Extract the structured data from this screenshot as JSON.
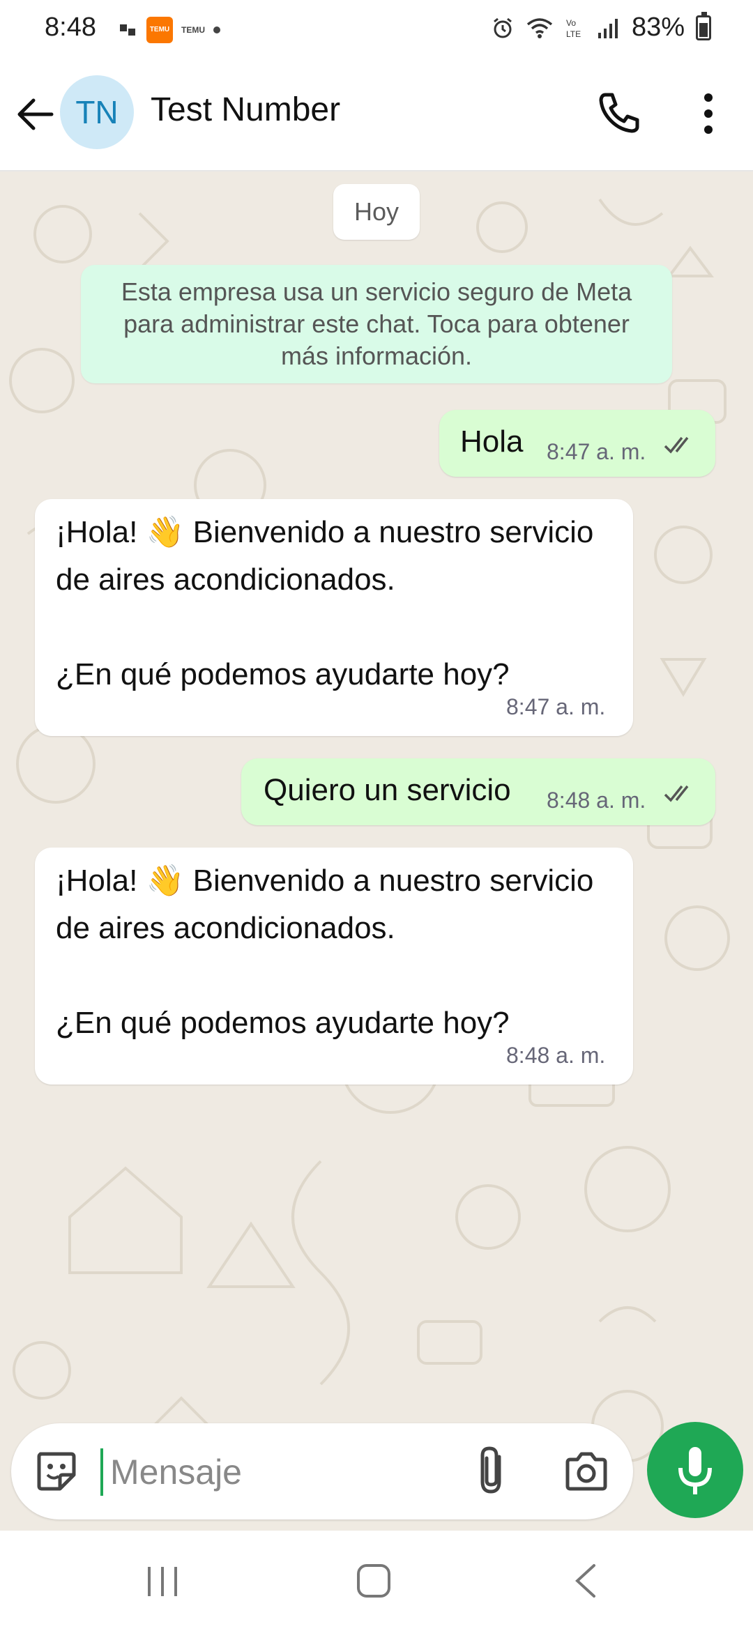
{
  "status_bar": {
    "time": "8:48",
    "temu_label": "TEMU",
    "battery_pct": "83%",
    "icons": [
      "gallery-icon",
      "temu-icon",
      "temu-icon",
      "dot-icon",
      "alarm-icon",
      "wifi-icon",
      "volte-icon",
      "signal-icon",
      "battery-icon"
    ]
  },
  "header": {
    "avatar_initials": "TN",
    "contact_name": "Test Number",
    "avatar_bg": "#cfe9f7",
    "avatar_fg": "#1782b8"
  },
  "chat": {
    "date_chip": "Hoy",
    "notice": "Esta empresa usa un servicio seguro de Meta para administrar este chat. Toca para obtener más información.",
    "messages": [
      {
        "direction": "out",
        "text": "Hola",
        "time": "8:47 a. m.",
        "status": "read"
      },
      {
        "direction": "in",
        "text": "¡Hola! 👋 Bienvenido a nuestro servicio de aires acondicionados.\n\n¿En qué podemos ayudarte hoy?",
        "time": "8:47 a. m."
      },
      {
        "direction": "out",
        "text": "Quiero un servicio",
        "time": "8:48 a. m.",
        "status": "read"
      },
      {
        "direction": "in",
        "text": "¡Hola! 👋 Bienvenido a nuestro servicio de aires acondicionados.\n\n¿En qué podemos ayudarte hoy?",
        "time": "8:48 a. m."
      }
    ]
  },
  "composer": {
    "placeholder": "Mensaje"
  },
  "colors": {
    "accent": "#1fa855",
    "out_bubble": "#d9fdd3",
    "notice_bg": "#d9fbe8",
    "chat_bg": "#efeae2"
  }
}
